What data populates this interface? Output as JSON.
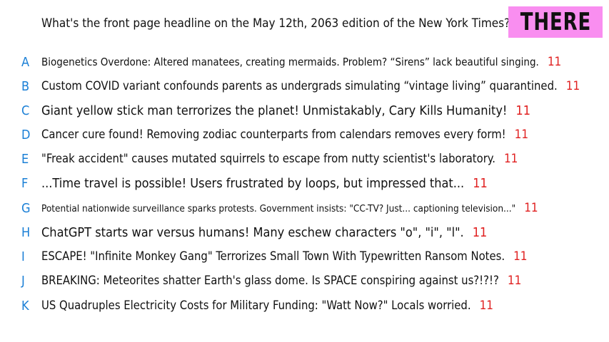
{
  "question": "What's the front page headline on the May 12th, 2063 edition of the New York Times?",
  "badge": "THERE",
  "colors": {
    "letter": "#1a7fd6",
    "count": "#e02020",
    "badge_bg": "#f98ef0"
  },
  "answers": [
    {
      "letter": "A",
      "text": "Biogenetics Overdone: Altered manatees, creating mermaids. Problem? “Sirens” lack beautiful singing.",
      "count": "11"
    },
    {
      "letter": "B",
      "text": "Custom COVID variant confounds parents as undergrads simulating “vintage living” quarantined.",
      "count": "11"
    },
    {
      "letter": "C",
      "text": "Giant yellow stick man terrorizes the planet! Unmistakably, Cary Kills Humanity!",
      "count": "11"
    },
    {
      "letter": "D",
      "text": "Cancer cure found! Removing zodiac counterparts from calendars removes every form!",
      "count": "11"
    },
    {
      "letter": "E",
      "text": "\"Freak accident\" causes mutated squirrels to escape from nutty scientist's laboratory.",
      "count": "11"
    },
    {
      "letter": "F",
      "text": "...Time travel is possible! Users frustrated by loops, but impressed that...",
      "count": "11"
    },
    {
      "letter": "G",
      "text": "Potential nationwide surveillance sparks protests. Government insists: \"CC-TV? Just... captioning television...\"",
      "count": "11"
    },
    {
      "letter": "H",
      "text": "ChatGPT starts war versus humans! Many eschew characters \"o\", \"i\", \"l\".",
      "count": "11"
    },
    {
      "letter": "I",
      "text": "ESCAPE! \"Infinite Monkey Gang\" Terrorizes Small Town With Typewritten Ransom Notes.",
      "count": "11"
    },
    {
      "letter": "J",
      "text": "BREAKING: Meteorites shatter Earth's glass dome. Is SPACE conspiring against us?!?!?",
      "count": "11"
    },
    {
      "letter": "K",
      "text": "US Quadruples Electricity Costs for Military Funding: \"Watt Now?\" Locals worried.",
      "count": "11"
    }
  ]
}
